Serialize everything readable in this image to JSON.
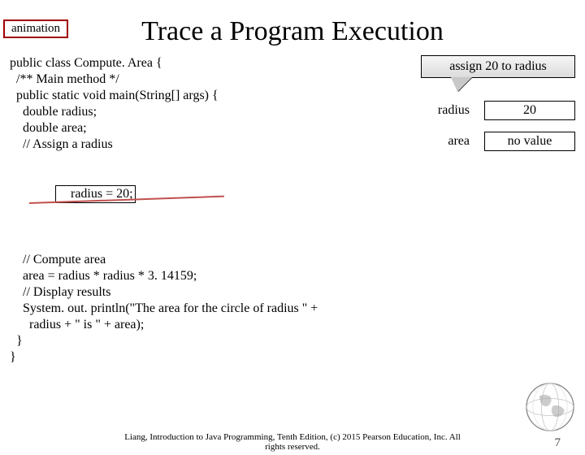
{
  "badge": "animation",
  "title": "Trace a Program Execution",
  "code": {
    "l1": "public class Compute. Area {",
    "l2": "  /** Main method */",
    "l3": "  public static void main(String[] args) {",
    "l4": "    double radius;",
    "l5": "    double area;",
    "blank1": "",
    "l6": "    // Assign a radius",
    "l7": "    radius = 20;",
    "blank2": "",
    "l8": "    // Compute area",
    "l9": "    area = radius * radius * 3. 14159;",
    "blank3": "",
    "l10": "    // Display results",
    "l11": "    System. out. println(\"The area for the circle of radius \" +",
    "l12": "      radius + \" is \" + area);",
    "l13": "  }",
    "l14": "}"
  },
  "callout": "assign 20 to radius",
  "vars": {
    "radius_label": "radius",
    "radius_value": "20",
    "area_label": "area",
    "area_value": "no value"
  },
  "footer_line1": "Liang, Introduction to Java Programming, Tenth Edition, (c) 2015 Pearson Education, Inc. All",
  "footer_line2": "rights reserved.",
  "page": "7"
}
